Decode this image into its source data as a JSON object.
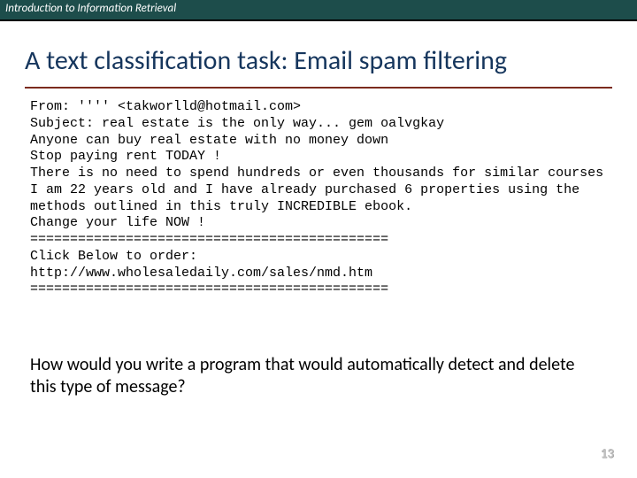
{
  "header": {
    "course": "Introduction to Information Retrieval"
  },
  "title": "A text classification task: Email spam filtering",
  "email": {
    "from": "From: '''' <takworlld@hotmail.com>",
    "subject": "Subject: real estate is the only way... gem oalvgkay",
    "l1": "Anyone can buy real estate with no money down",
    "l2": "Stop paying rent TODAY !",
    "l3": "There is no need to spend hundreds or even thousands for similar courses",
    "l4": "I am 22 years old and I have already purchased 6 properties using the",
    "l5": "methods outlined in this truly INCREDIBLE ebook.",
    "l6": "Change your life NOW !",
    "sep1": "=============================================",
    "l7": "Click Below to order:",
    "l8": "http://www.wholesaledaily.com/sales/nmd.htm",
    "sep2": "============================================="
  },
  "question": "How would you write a program that would automatically detect and delete this type of message?",
  "page": "13"
}
